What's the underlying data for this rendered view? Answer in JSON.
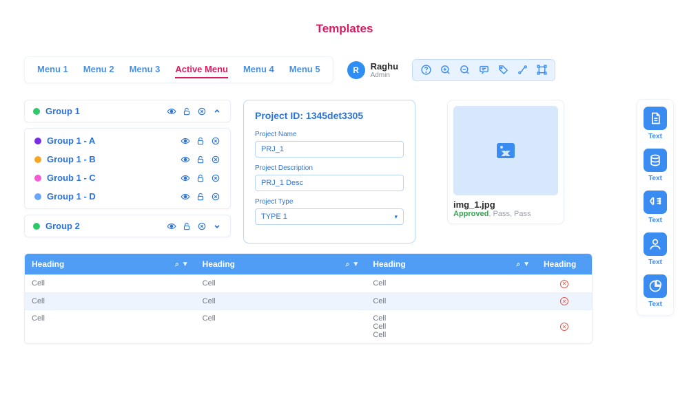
{
  "page_title": "Templates",
  "menu": {
    "items": [
      "Menu 1",
      "Menu 2",
      "Menu 3",
      "Active Menu",
      "Menu 4",
      "Menu 5"
    ],
    "active_index": 3
  },
  "user": {
    "initial": "R",
    "name": "Raghu",
    "role": "Admin"
  },
  "toolbar_icons": [
    "help",
    "zoom-in",
    "zoom-out",
    "comment",
    "tag",
    "connector",
    "bounding-box"
  ],
  "groups": {
    "main": [
      {
        "label": "Group 1",
        "color": "#2fc768",
        "expanded": true
      },
      {
        "label": "Group 2",
        "color": "#2fc768",
        "expanded": false
      }
    ],
    "sub": [
      {
        "label": "Group 1 - A",
        "color": "#7a2fe7"
      },
      {
        "label": "Group 1 - B",
        "color": "#f5a623"
      },
      {
        "label": "Groub 1 - C",
        "color": "#f25cd8"
      },
      {
        "label": "Group 1 - D",
        "color": "#6aa6f7"
      }
    ]
  },
  "form": {
    "title_prefix": "Project ID:",
    "project_id": "1345det3305",
    "name_label": "Project Name",
    "name_value": "PRJ_1",
    "desc_label": "Project Description",
    "desc_value": "PRJ_1 Desc",
    "type_label": "Project Type",
    "type_value": "TYPE 1"
  },
  "image_card": {
    "filename": "img_1.jpg",
    "status_primary": "Approved",
    "status_rest": ", Pass, Pass"
  },
  "table": {
    "headers": [
      "Heading",
      "Heading",
      "Heading",
      "Heading"
    ],
    "rows": [
      {
        "c1": "Cell",
        "c2": "Cell",
        "c3": "Cell"
      },
      {
        "c1": "Cell",
        "c2": "Cell",
        "c3": "Cell"
      },
      {
        "c1": "Cell",
        "c2": "Cell",
        "c3": [
          "Cell",
          "Cell",
          "Cell"
        ]
      }
    ]
  },
  "rail": {
    "labels": [
      "Text",
      "Text",
      "Text",
      "Text",
      "Text"
    ],
    "icons": [
      "document",
      "database",
      "brain",
      "person",
      "pie"
    ]
  },
  "colors": {
    "accent_blue": "#3a8cf0",
    "accent_pink": "#d81b60",
    "panel_bg": "#e9f2ff"
  }
}
